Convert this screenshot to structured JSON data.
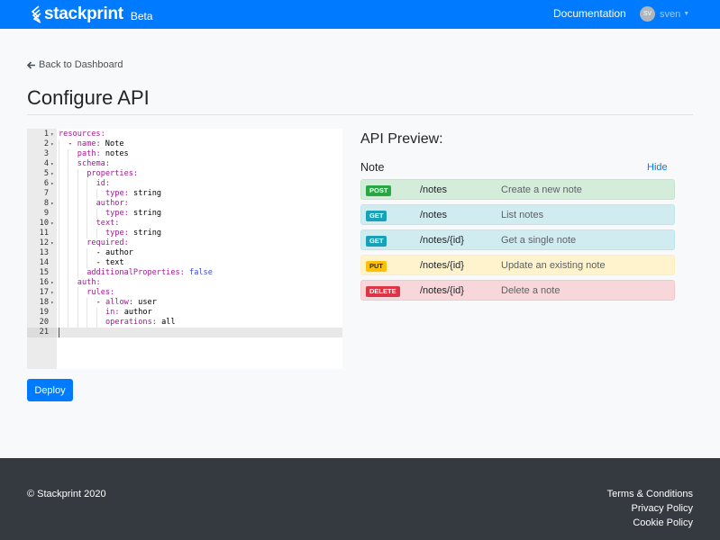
{
  "navbar": {
    "brand": "stackprint",
    "badge": "Beta",
    "documentation": "Documentation",
    "user_initials": "SV",
    "user_name": "sven"
  },
  "main": {
    "back_link": "Back to Dashboard",
    "title": "Configure API",
    "deploy_label": "Deploy"
  },
  "editor": {
    "lines": [
      {
        "n": "1",
        "fold": true,
        "indent": 0,
        "html": "<span class=\"k\">resources:</span>"
      },
      {
        "n": "2",
        "fold": true,
        "indent": 1,
        "html": "- <span class=\"k\">name:</span> Note"
      },
      {
        "n": "3",
        "fold": false,
        "indent": 2,
        "html": "<span class=\"k\">path:</span> notes"
      },
      {
        "n": "4",
        "fold": true,
        "indent": 2,
        "html": "<span class=\"k\">schema:</span>"
      },
      {
        "n": "5",
        "fold": true,
        "indent": 3,
        "html": "<span class=\"k\">properties:</span>"
      },
      {
        "n": "6",
        "fold": true,
        "indent": 4,
        "html": "<span class=\"k\">id:</span>"
      },
      {
        "n": "7",
        "fold": false,
        "indent": 5,
        "html": "<span class=\"k\">type:</span> string"
      },
      {
        "n": "8",
        "fold": true,
        "indent": 4,
        "html": "<span class=\"k\">author:</span>"
      },
      {
        "n": "9",
        "fold": false,
        "indent": 5,
        "html": "<span class=\"k\">type:</span> string"
      },
      {
        "n": "10",
        "fold": true,
        "indent": 4,
        "html": "<span class=\"k\">text:</span>"
      },
      {
        "n": "11",
        "fold": false,
        "indent": 5,
        "html": "<span class=\"k\">type:</span> string"
      },
      {
        "n": "12",
        "fold": true,
        "indent": 3,
        "html": "<span class=\"k\">required:</span>"
      },
      {
        "n": "13",
        "fold": false,
        "indent": 4,
        "html": "- author"
      },
      {
        "n": "14",
        "fold": false,
        "indent": 4,
        "html": "- text"
      },
      {
        "n": "15",
        "fold": false,
        "indent": 3,
        "html": "<span class=\"k\">additionalProperties:</span> <span class=\"b\">false</span>"
      },
      {
        "n": "16",
        "fold": true,
        "indent": 2,
        "html": "<span class=\"k\">auth:</span>"
      },
      {
        "n": "17",
        "fold": true,
        "indent": 3,
        "html": "<span class=\"k\">rules:</span>"
      },
      {
        "n": "18",
        "fold": true,
        "indent": 4,
        "html": "- <span class=\"k\">allow:</span> user"
      },
      {
        "n": "19",
        "fold": false,
        "indent": 5,
        "html": "<span class=\"k\">in:</span> author"
      },
      {
        "n": "20",
        "fold": false,
        "indent": 5,
        "html": "<span class=\"k\">operations:</span> all"
      },
      {
        "n": "21",
        "fold": false,
        "indent": 0,
        "html": "",
        "active": true
      }
    ]
  },
  "preview": {
    "title": "API Preview:",
    "resource": "Note",
    "hide_label": "Hide",
    "endpoints": [
      {
        "method": "POST",
        "path": "/notes",
        "desc": "Create a new note",
        "kind": "post",
        "badge_bg": "#28a745",
        "badge_fg": "#ffffff"
      },
      {
        "method": "GET",
        "path": "/notes",
        "desc": "List notes",
        "kind": "get",
        "badge_bg": "#17a2b8",
        "badge_fg": "#ffffff"
      },
      {
        "method": "GET",
        "path": "/notes/{id}",
        "desc": "Get a single note",
        "kind": "get",
        "badge_bg": "#17a2b8",
        "badge_fg": "#ffffff"
      },
      {
        "method": "PUT",
        "path": "/notes/{id}",
        "desc": "Update an existing note",
        "kind": "put",
        "badge_bg": "#ffc107",
        "badge_fg": "#212529"
      },
      {
        "method": "DELETE",
        "path": "/notes/{id}",
        "desc": "Delete a note",
        "kind": "delete",
        "badge_bg": "#dc3545",
        "badge_fg": "#ffffff"
      }
    ]
  },
  "footer": {
    "copyright": "© Stackprint 2020",
    "links": [
      "Terms & Conditions",
      "Privacy Policy",
      "Cookie Policy"
    ]
  },
  "colors": {
    "primary": "#007bff",
    "footer_bg": "#343a40",
    "yaml_key": "#a31994",
    "yaml_bool": "#3a4bd1"
  }
}
